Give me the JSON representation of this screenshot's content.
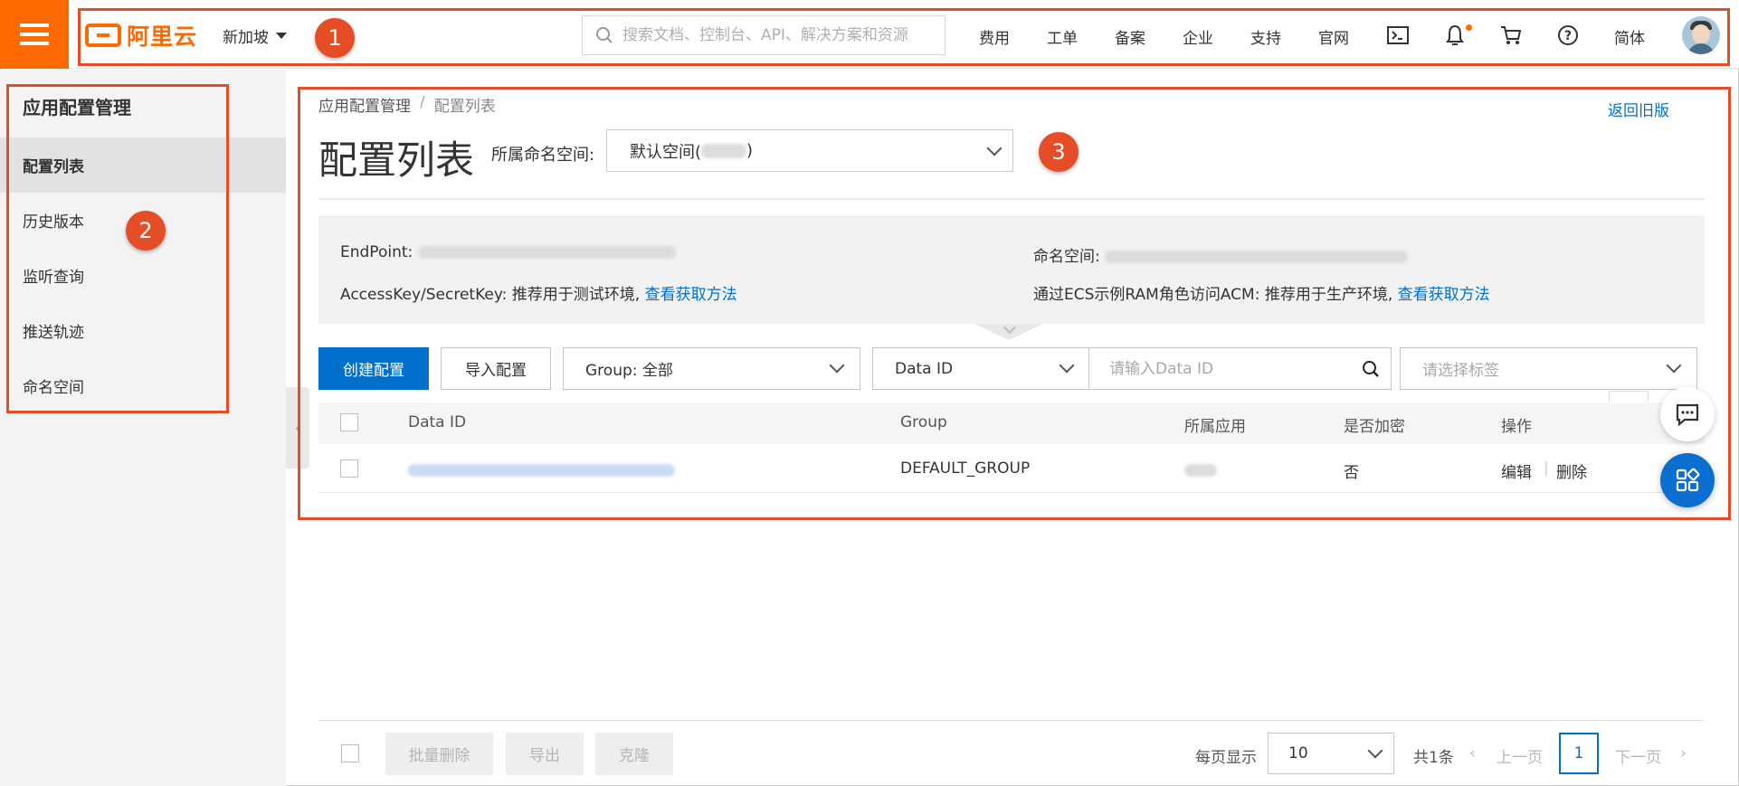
{
  "topbar": {
    "brand": "阿里云",
    "region": "新加坡",
    "search_placeholder": "搜索文档、控制台、API、解决方案和资源",
    "nav": [
      "费用",
      "工单",
      "备案",
      "企业",
      "支持",
      "官网"
    ],
    "lang": "简体",
    "icons": [
      "terminal-icon",
      "bell-icon",
      "cart-icon",
      "help-icon"
    ]
  },
  "sidebar": {
    "title": "应用配置管理",
    "items": [
      {
        "label": "配置列表",
        "active": true
      },
      {
        "label": "历史版本",
        "active": false
      },
      {
        "label": "监听查询",
        "active": false
      },
      {
        "label": "推送轨迹",
        "active": false
      },
      {
        "label": "命名空间",
        "active": false
      }
    ]
  },
  "breadcrumb": {
    "root": "应用配置管理",
    "sep": "/",
    "current": "配置列表"
  },
  "header": {
    "back_link": "返回旧版",
    "title": "配置列表",
    "namespace_label": "所属命名空间:",
    "namespace_value_prefix": "默认空间(",
    "namespace_value_suffix": ")"
  },
  "info": {
    "endpoint_label": "EndPoint:",
    "namespace_label": "命名空间:",
    "access_text": "AccessKey/SecretKey: 推荐用于测试环境,",
    "access_link": "查看获取方法",
    "ecs_text": "通过ECS示例RAM角色访问ACM: 推荐用于生产环境,",
    "ecs_link": "查看获取方法"
  },
  "toolbar": {
    "create": "创建配置",
    "import": "导入配置",
    "group_select": "Group: 全部",
    "dataid_select": "Data ID",
    "dataid_placeholder": "请输入Data ID",
    "tag_placeholder": "请选择标签"
  },
  "table": {
    "columns": [
      "Data ID",
      "Group",
      "所属应用",
      "是否加密",
      "操作"
    ],
    "rows": [
      {
        "group": "DEFAULT_GROUP",
        "encrypted": "否",
        "edit": "编辑",
        "delete": "删除"
      }
    ]
  },
  "footer": {
    "batch_delete": "批量删除",
    "export": "导出",
    "clone": "克隆",
    "page_size_label": "每页显示",
    "page_size": "10",
    "total": "共1条",
    "prev": "上一页",
    "page": "1",
    "next": "下一页"
  },
  "annotations": [
    "1",
    "2",
    "3"
  ],
  "colors": {
    "brand": "#ff6a00",
    "link": "#0070cc",
    "annotation": "#e44d26"
  }
}
